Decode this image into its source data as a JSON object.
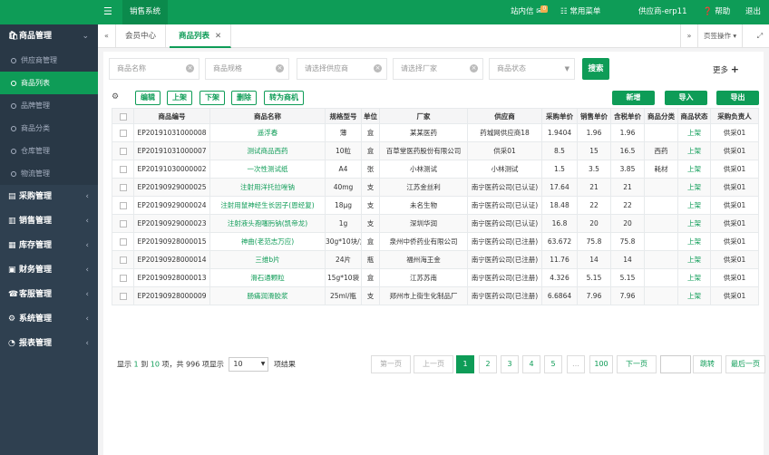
{
  "topbar": {
    "system_tab": "销售系统",
    "messages": "站内信",
    "message_count": "0",
    "common_menu": "常用菜单",
    "user": "供应商-erp11",
    "help": "帮助",
    "logout": "退出"
  },
  "sidebar": {
    "groups": [
      {
        "label": "商品管理",
        "icon": "cart-icon"
      },
      {
        "label": "采购管理",
        "icon": "doc-icon"
      },
      {
        "label": "销售管理",
        "icon": "chart-icon"
      },
      {
        "label": "库存管理",
        "icon": "store-icon"
      },
      {
        "label": "财务管理",
        "icon": "money-icon"
      },
      {
        "label": "客服管理",
        "icon": "service-icon"
      },
      {
        "label": "系统管理",
        "icon": "gear-icon"
      },
      {
        "label": "报表管理",
        "icon": "report-icon"
      }
    ],
    "sub_items": [
      {
        "label": "供应商管理"
      },
      {
        "label": "商品列表"
      },
      {
        "label": "品牌管理"
      },
      {
        "label": "商品分类"
      },
      {
        "label": "仓库管理"
      },
      {
        "label": "物流管理"
      }
    ]
  },
  "tabs": {
    "items": [
      {
        "label": "会员中心"
      },
      {
        "label": "商品列表"
      }
    ],
    "page_ops": "页签操作"
  },
  "search": {
    "name_placeholder": "商品名称",
    "spec_placeholder": "商品规格",
    "supplier_placeholder": "请选择供应商",
    "factory_placeholder": "请选择厂家",
    "status_placeholder": "商品状态",
    "search_button": "搜索",
    "more": "更多"
  },
  "toolbar": {
    "edit": "编辑",
    "on_shelf": "上架",
    "off_shelf": "下架",
    "delete": "删除",
    "convert": "转为商机",
    "add": "新增",
    "import": "导入",
    "export": "导出"
  },
  "table": {
    "headers": [
      "商品编号",
      "商品名称",
      "规格型号",
      "单位",
      "厂家",
      "供应商",
      "采购单价",
      "销售单价",
      "含税单价",
      "商品分类",
      "商品状态",
      "采购负责人"
    ],
    "rows": [
      [
        "EP20191031000008",
        "遥浮春",
        "薄",
        "盒",
        "某某医药",
        "药城网供应商18",
        "1.9404",
        "1.96",
        "1.96",
        "",
        "上架",
        "供采01"
      ],
      [
        "EP20191031000007",
        "测试商品西药",
        "10粒",
        "盒",
        "百草堂医药股份有限公司",
        "供采01",
        "8.5",
        "15",
        "16.5",
        "西药",
        "上架",
        "供采01"
      ],
      [
        "EP20191030000002",
        "一次性测试纸",
        "A4",
        "张",
        "小林测试",
        "小林测试",
        "1.5",
        "3.5",
        "3.85",
        "耗材",
        "上架",
        "供采01"
      ],
      [
        "EP20190929000025",
        "注射用洋托拉唑钠",
        "40mg",
        "支",
        "江苏金丝利",
        "南宁医药公司(已认证)",
        "17.64",
        "21",
        "21",
        "",
        "上架",
        "供采01"
      ],
      [
        "EP20190929000024",
        "注射用鼠神经生长因子(恩经复)",
        "18μg",
        "支",
        "未名生物",
        "南宁医药公司(已认证)",
        "18.48",
        "22",
        "22",
        "",
        "上架",
        "供采01"
      ],
      [
        "EP20190929000023",
        "注射液头孢噻肟钠(凯帝龙)",
        "1g",
        "支",
        "深圳华润",
        "南宁医药公司(已认证)",
        "16.8",
        "20",
        "20",
        "",
        "上架",
        "供采01"
      ],
      [
        "EP20190928000015",
        "神曲(老范志万应)",
        "30g*10块/盒",
        "盒",
        "泉州中侨药业有限公司",
        "南宁医药公司(已注册)",
        "63.672",
        "75.8",
        "75.8",
        "",
        "上架",
        "供采01"
      ],
      [
        "EP20190928000014",
        "三维b片",
        "24片",
        "瓶",
        "福州海王金",
        "南宁医药公司(已注册)",
        "11.76",
        "14",
        "14",
        "",
        "上架",
        "供采01"
      ],
      [
        "EP20190928000013",
        "滑石通颗粒",
        "15g*10袋",
        "盒",
        "江苏苏南",
        "南宁医药公司(已注册)",
        "4.326",
        "5.15",
        "5.15",
        "",
        "上架",
        "供采01"
      ],
      [
        "EP20190928000009",
        "肠痛润滑胶浆",
        "25ml/瓶",
        "支",
        "郑州市上街生化制品厂",
        "南宁医药公司(已注册)",
        "6.6864",
        "7.96",
        "7.96",
        "",
        "上架",
        "供采01"
      ]
    ]
  },
  "pager": {
    "show": "显示",
    "from": "1",
    "to_word": "到",
    "to": "10",
    "items_word": "项，共",
    "total": "996",
    "items_show": "项显示",
    "page_size": "10",
    "result_word": "项结果",
    "first": "第一页",
    "prev": "上一页",
    "pages": [
      "1",
      "2",
      "3",
      "4",
      "5",
      "…",
      "100"
    ],
    "next": "下一页",
    "jump": "跳转",
    "last": "最后一页"
  }
}
